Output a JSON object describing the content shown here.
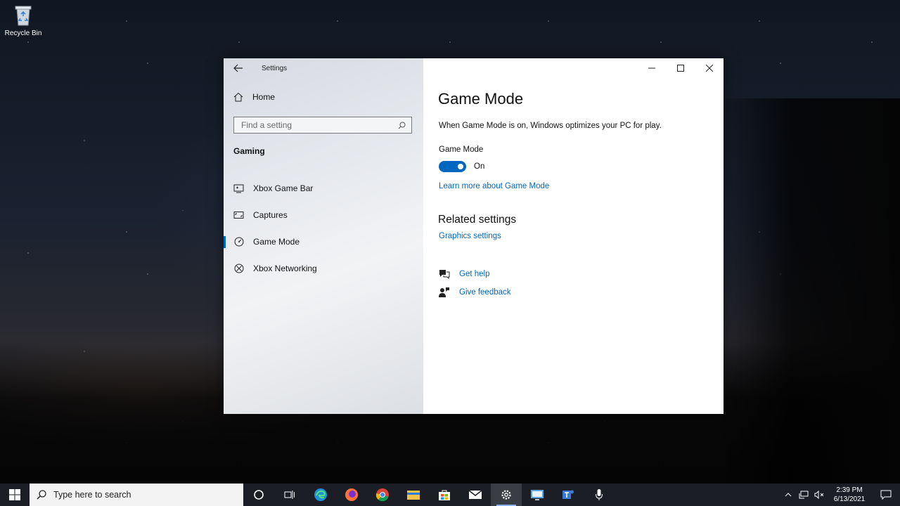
{
  "desktop": {
    "recycle_bin_label": "Recycle Bin"
  },
  "window": {
    "app_title": "Settings",
    "home_label": "Home",
    "search_placeholder": "Find a setting",
    "section_title": "Gaming",
    "nav_items": [
      {
        "label": "Xbox Game Bar",
        "icon": "xbox-game-bar-icon",
        "active": false
      },
      {
        "label": "Captures",
        "icon": "captures-icon",
        "active": false
      },
      {
        "label": "Game Mode",
        "icon": "game-mode-icon",
        "active": true
      },
      {
        "label": "Xbox Networking",
        "icon": "xbox-icon",
        "active": false
      }
    ]
  },
  "content": {
    "title": "Game Mode",
    "description": "When Game Mode is on, Windows optimizes your PC for play.",
    "toggle_label": "Game Mode",
    "toggle_state": "On",
    "learn_more_link": "Learn more about Game Mode",
    "related_title": "Related settings",
    "graphics_link": "Graphics settings",
    "get_help": "Get help",
    "give_feedback": "Give feedback"
  },
  "taskbar": {
    "search_placeholder": "Type here to search",
    "time": "2:39 PM",
    "date": "6/13/2021",
    "apps": [
      "cortana-icon",
      "task-view-icon",
      "edge-icon",
      "firefox-icon",
      "chrome-icon",
      "file-explorer-icon",
      "store-icon",
      "mail-icon",
      "settings-icon",
      "remote-desktop-icon",
      "teams-icon",
      "microphone-icon"
    ]
  },
  "colors": {
    "accent": "#0067c0",
    "taskbar": "#1b1e24"
  }
}
